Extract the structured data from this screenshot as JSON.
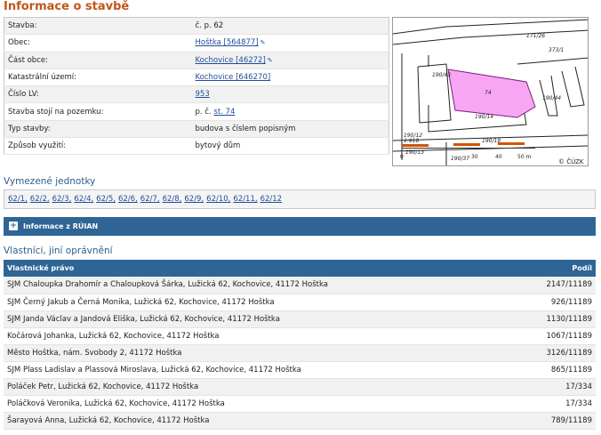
{
  "page_title": "Informace o stavbě",
  "building_info": [
    {
      "label": "Stavba:",
      "value": "č. p. 62",
      "link": false,
      "edit": false
    },
    {
      "label": "Obec:",
      "value": "Hoštka [564877]",
      "link": true,
      "edit": true
    },
    {
      "label": "Část obce:",
      "value": "Kochovice [46272]",
      "link": true,
      "edit": true
    },
    {
      "label": "Katastrální území:",
      "value": "Kochovice [646270]",
      "link": true,
      "edit": false
    },
    {
      "label": "Číslo LV:",
      "value": "953",
      "link": true,
      "edit": false
    },
    {
      "label": "Stavba stojí na pozemku:",
      "value_prefix": "p. č.",
      "value": "st. 74",
      "link": true,
      "edit": false
    },
    {
      "label": "Typ stavby:",
      "value": "budova s číslem popisným",
      "link": false,
      "edit": false
    },
    {
      "label": "Způsob využití:",
      "value": "bytový dům",
      "link": false,
      "edit": false
    }
  ],
  "map": {
    "parcel_labels": [
      "171/26",
      "373/1",
      "190/43",
      "74",
      "190/44",
      "190/14",
      "190/12",
      "1:918",
      "190/19",
      "190/13",
      "190/37",
      "30",
      "40",
      "50 m",
      "0"
    ],
    "copyright": "© ČÚZK",
    "highlight_color": "#f7a6f3",
    "scale_color": "#d35400"
  },
  "units_section": {
    "heading": "Vymezené jednotky",
    "units": [
      "62/1,",
      "62/2,",
      "62/3,",
      "62/4,",
      "62/5,",
      "62/6,",
      "62/7,",
      "62/8,",
      "62/9,",
      "62/10,",
      "62/11,",
      "62/12"
    ]
  },
  "ruian_bar": {
    "plus": "+",
    "label": "Informace z RÚIAN"
  },
  "owners_section": {
    "heading": "Vlastníci, jiní oprávnění",
    "col_owner": "Vlastnické právo",
    "col_share": "Podíl",
    "rows": [
      {
        "owner": "SJM Chaloupka Drahomír a Chaloupková Šárka, Lužická 62, Kochovice, 41172 Hoštka",
        "share": "2147/11189"
      },
      {
        "owner": "SJM Černý Jakub a Černá Monika, Lužická 62, Kochovice, 41172 Hoštka",
        "share": "926/11189"
      },
      {
        "owner": "SJM Janda Václav a Jandová Eliška, Lužická 62, Kochovice, 41172 Hoštka",
        "share": "1130/11189"
      },
      {
        "owner": "Kočárová Johanka, Lužická 62, Kochovice, 41172 Hoštka",
        "share": "1067/11189"
      },
      {
        "owner": "Město Hoštka, nám. Svobody 2, 41172 Hoštka",
        "share": "3126/11189"
      },
      {
        "owner": "SJM Plass Ladislav a Plassová Miroslava, Lužická 62, Kochovice, 41172 Hoštka",
        "share": "865/11189"
      },
      {
        "owner": "Poláček Petr, Lužická 62, Kochovice, 41172 Hoštka",
        "share": "17/334"
      },
      {
        "owner": "Poláčková Veronika, Lužická 62, Kochovice, 41172 Hoštka",
        "share": "17/334"
      },
      {
        "owner": "Šarayová Anna, Lužická 62, Kochovice, 41172 Hoštka",
        "share": "789/11189"
      }
    ]
  }
}
